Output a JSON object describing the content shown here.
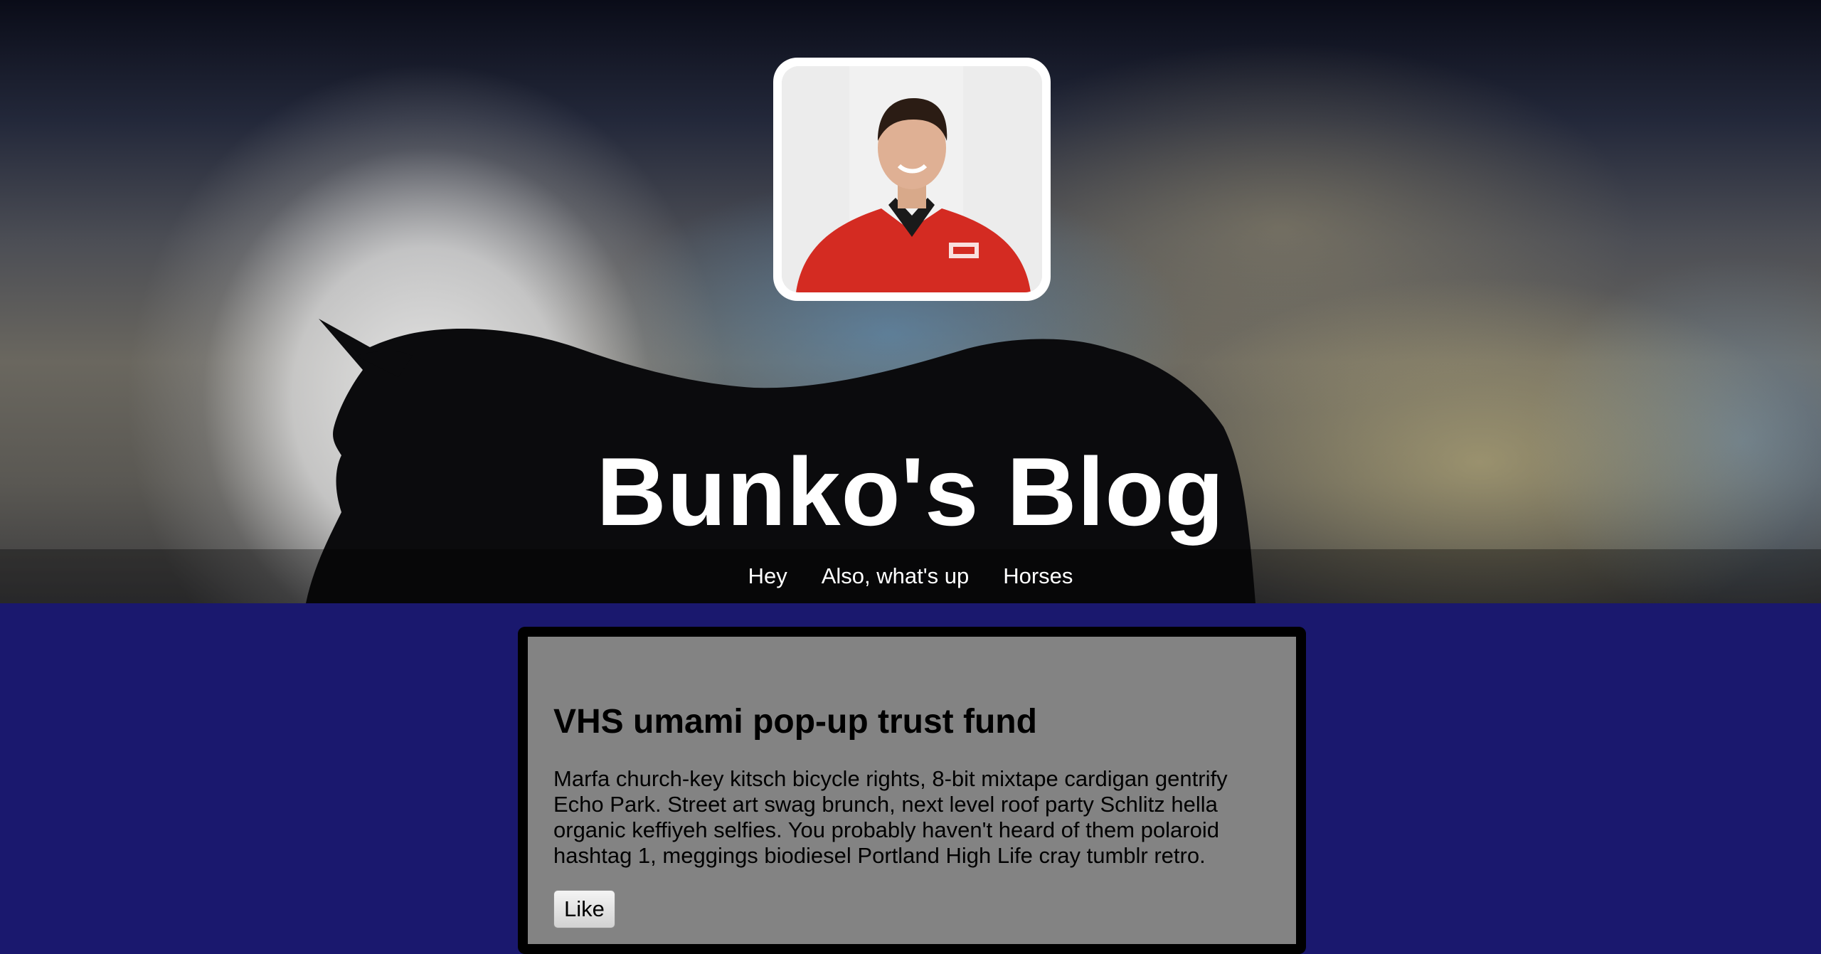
{
  "blog": {
    "title": "Bunko's Blog"
  },
  "nav": {
    "items": [
      {
        "label": "Hey"
      },
      {
        "label": "Also, what's up"
      },
      {
        "label": "Horses"
      }
    ]
  },
  "post": {
    "title": "VHS umami pop-up trust fund",
    "body": "Marfa church-key kitsch bicycle rights, 8-bit mixtape cardigan gentrify Echo Park. Street art swag brunch, next level roof party Schlitz hella organic keffiyeh selfies. You probably haven't heard of them polaroid hashtag 1, meggings biodiesel Portland High Life cray tumblr retro.",
    "like_label": "Like"
  },
  "colors": {
    "page_background": "#1a186e",
    "post_card_background": "#838383",
    "post_card_border": "#000000",
    "title_text": "#ffffff",
    "shirt_red": "#d42b22"
  },
  "icons": {
    "header_background": "horse-silhouette-moon-image",
    "avatar": "profile-photo"
  }
}
